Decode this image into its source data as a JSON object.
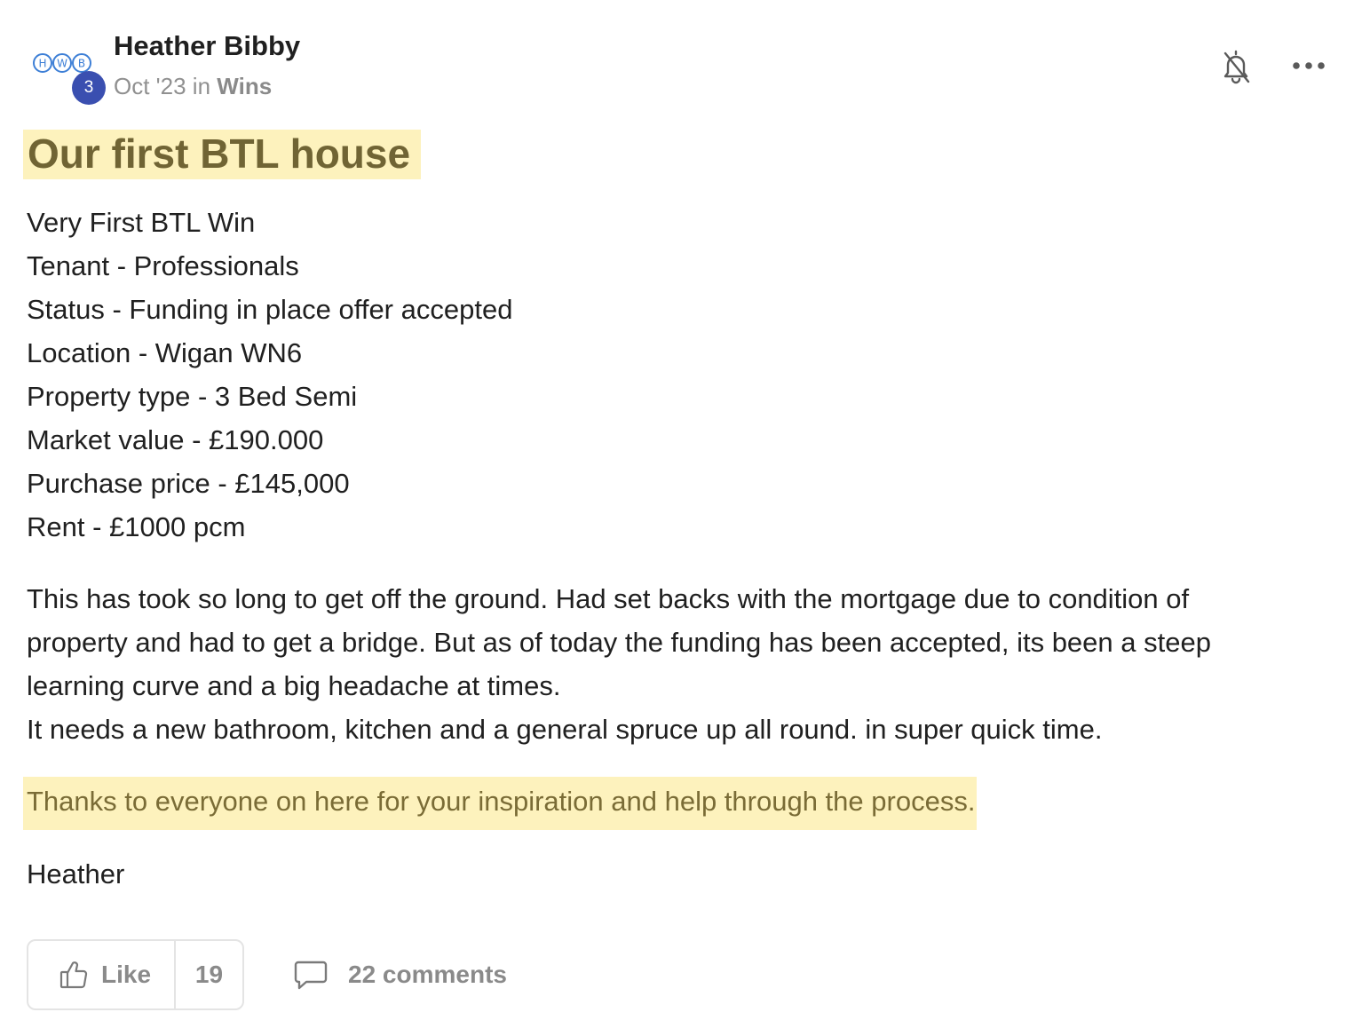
{
  "post": {
    "author": {
      "name": "Heather Bibby",
      "avatar_initials": [
        "H",
        "W",
        "B"
      ],
      "level": "3"
    },
    "meta": {
      "date": "Oct '23",
      "in_word": "in",
      "category": "Wins"
    },
    "header_icons": {
      "notify": "bell-off-icon",
      "more": "more-horizontal-icon"
    },
    "title": "Our first BTL house",
    "details": [
      "Very First BTL Win",
      "Tenant - Professionals",
      "Status - Funding in place offer accepted",
      "Location - Wigan WN6",
      "Property type - 3 Bed Semi",
      "Market value - £190.000",
      "Purchase price - £145,000",
      "Rent - £1000 pcm"
    ],
    "paragraph_lines": [
      "This has took so long to get off the ground. Had set backs with the mortgage due to condition of",
      "property and had to get a bridge. But as of today the funding has been accepted, its been a steep",
      "learning curve and a big headache at times.",
      "It needs a new bathroom, kitchen and a general spruce up all round. in super quick time."
    ],
    "thanks": "Thanks to everyone on here for your inspiration and help through the process.",
    "signoff": "Heather",
    "footer": {
      "like_label": "Like",
      "like_count": "19",
      "comments_label": "22 comments"
    }
  },
  "colors": {
    "highlight_bg": "#fdf2bd",
    "title_text": "#706434",
    "level_badge": "#3a4fb0",
    "muted_text": "#8a8a8a",
    "avatar_stroke": "#3d7fd6"
  }
}
